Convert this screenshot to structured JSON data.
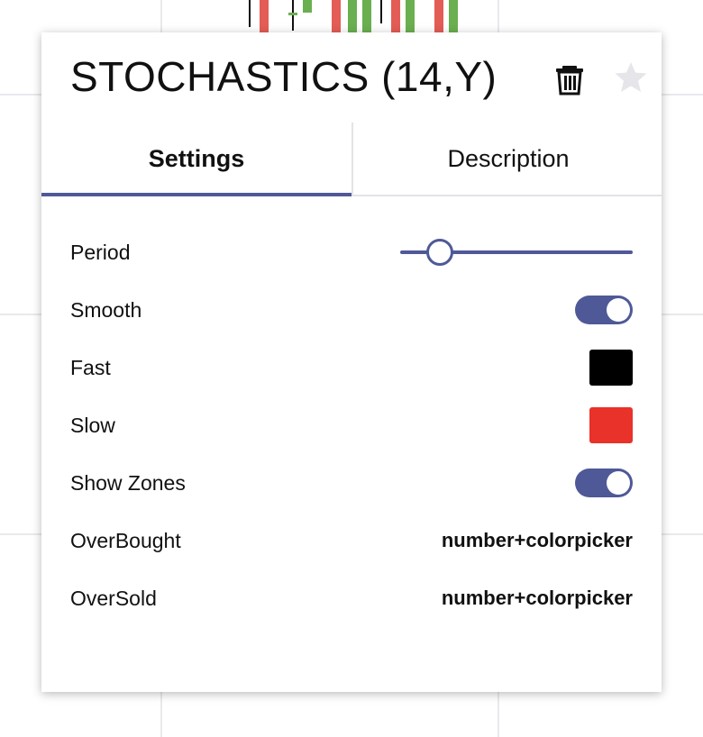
{
  "dialog": {
    "title": "STOCHASTICS (14,Y)",
    "icons": {
      "delete": "trash-icon",
      "favorite": "star-icon"
    }
  },
  "tabs": [
    {
      "label": "Settings",
      "active": true
    },
    {
      "label": "Description",
      "active": false
    }
  ],
  "settings": {
    "period": {
      "label": "Period",
      "value_fraction": 0.17
    },
    "smooth": {
      "label": "Smooth",
      "on": true
    },
    "fast": {
      "label": "Fast",
      "color": "#000000"
    },
    "slow": {
      "label": "Slow",
      "color": "#e8322a"
    },
    "show_zones": {
      "label": "Show Zones",
      "on": true
    },
    "overbought": {
      "label": "OverBought",
      "value": "number+colorpicker"
    },
    "oversold": {
      "label": "OverSold",
      "value": "number+colorpicker"
    }
  },
  "colors": {
    "accent": "#4f5997",
    "candle_up": "#6aaf50",
    "candle_down": "#e45c56"
  }
}
